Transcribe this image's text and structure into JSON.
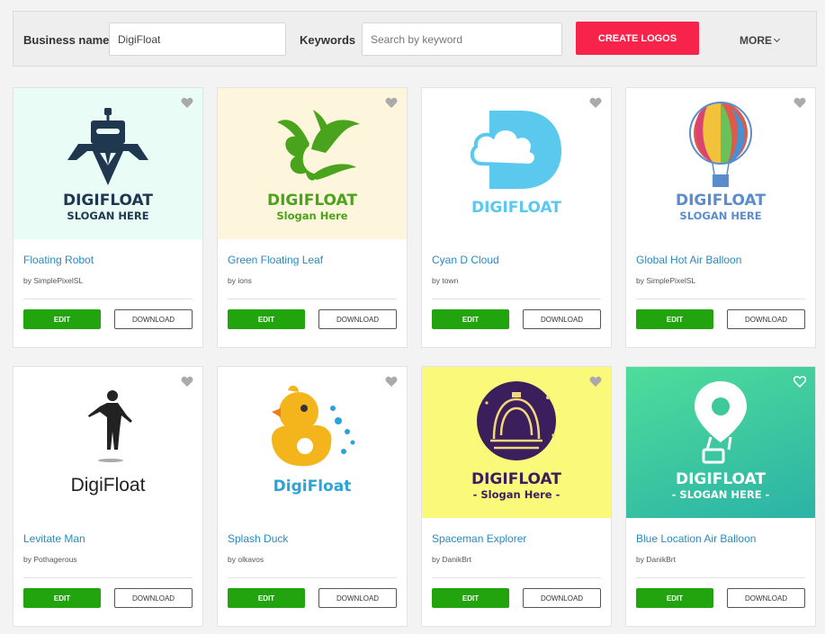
{
  "search": {
    "business_label": "Business name",
    "business_value": "DigiFloat",
    "keywords_label": "Keywords",
    "keywords_placeholder": "Search by keyword",
    "create_label": "CREATE LOGOS",
    "more_label": "MORE"
  },
  "cards": [
    {
      "title": "Floating Robot",
      "author": "by SimplePixelSL",
      "bg": "#e9fcf6",
      "logo_text": "DIGIFLOAT",
      "slogan": "SLOGAN HERE",
      "icon": "robot-logo-icon",
      "liked": false
    },
    {
      "title": "Green Floating Leaf",
      "author": "by ions",
      "bg": "#fef6dc",
      "logo_text": "DIGIFLOAT",
      "slogan": "Slogan Here",
      "icon": "leaf-logo-icon",
      "liked": false
    },
    {
      "title": "Cyan D Cloud",
      "author": "by town",
      "bg": "#ffffff",
      "logo_text": "DIGIFLOAT",
      "slogan": "",
      "icon": "cloud-d-logo-icon",
      "liked": false
    },
    {
      "title": "Global Hot Air Balloon",
      "author": "by SimplePixelSL",
      "bg": "#ffffff",
      "logo_text": "DIGIFLOAT",
      "slogan": "SLOGAN HERE",
      "icon": "balloon-logo-icon",
      "liked": false
    },
    {
      "title": "Levitate Man",
      "author": "by Pothagerous",
      "bg": "#ffffff",
      "logo_text": "DigiFloat",
      "slogan": "",
      "icon": "levitating-man-logo-icon",
      "liked": false
    },
    {
      "title": "Splash Duck",
      "author": "by olkavos",
      "bg": "#ffffff",
      "logo_text": "DigiFloat",
      "slogan": "",
      "icon": "duck-logo-icon",
      "liked": false
    },
    {
      "title": "Spaceman Explorer",
      "author": "by DanikBrt",
      "bg": "#fbf97a",
      "logo_text": "DIGIFLOAT",
      "slogan": "- Slogan Here -",
      "icon": "astronaut-logo-icon",
      "liked": false
    },
    {
      "title": "Blue Location Air Balloon",
      "author": "by DanikBrt",
      "bg": "#3ec998",
      "logo_text": "DIGIFLOAT",
      "slogan": "- SLOGAN HERE -",
      "icon": "location-balloon-logo-icon",
      "liked": false
    }
  ],
  "buttons": {
    "edit": "EDIT",
    "download": "DOWNLOAD"
  },
  "colors": {
    "accent": "#f7234a",
    "edit": "#22a40e",
    "link": "#2a8ac0"
  }
}
